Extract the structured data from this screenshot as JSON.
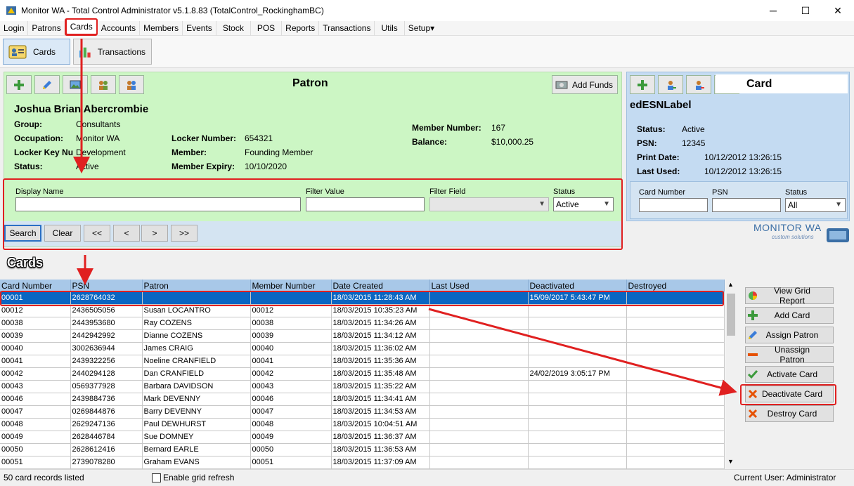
{
  "window": {
    "title": "Monitor WA - Total Control Administrator v5.1.8.83 (TotalControl_RockinghamBC)",
    "buttons": [
      "─",
      "☐",
      "✕"
    ]
  },
  "menu": [
    "Login",
    "Patrons",
    "Cards",
    "Accounts",
    "Members",
    "Events",
    "Stock",
    "POS",
    "Reports",
    "Transactions",
    "Utils",
    "Setup▾"
  ],
  "modules": {
    "cards": "Cards",
    "transactions": "Transactions"
  },
  "patron": {
    "title": "Patron",
    "add_funds": "Add Funds",
    "name": "Joshua Brian Abercrombie",
    "group_label": "Group:",
    "group": "Consultants",
    "occupation_label": "Occupation:",
    "occupation": "Monitor WA",
    "locker_key_label": "Locker Key Nu",
    "locker_key": "Development",
    "status_label": "Status:",
    "status": "Active",
    "locker_number_label": "Locker Number:",
    "locker_number": "654321",
    "member_label": "Member:",
    "member": "Founding Member",
    "member_expiry_label": "Member Expiry:",
    "member_expiry": "10/10/2020",
    "member_number_label": "Member Number:",
    "member_number": "167",
    "balance_label": "Balance:",
    "balance": "$10,000.25"
  },
  "filter": {
    "display_name": "Display Name",
    "filter_value": "Filter Value",
    "filter_field": "Filter Field",
    "status": "Status",
    "status_value": "Active",
    "search": "Search",
    "clear": "Clear",
    "first": "<<",
    "prev": "<",
    "next": ">",
    "last": ">>"
  },
  "card": {
    "title": "Card",
    "esn": "edESNLabel",
    "status_label": "Status:",
    "status": "Active",
    "psn_label": "PSN:",
    "psn": "12345",
    "print_date_label": "Print Date:",
    "print_date": "10/12/2012 13:26:15",
    "last_used_label": "Last Used:",
    "last_used": "10/12/2012 13:26:15",
    "card_number": "Card Number",
    "psn_filter": "PSN",
    "status_filter": "Status",
    "status_filter_value": "All"
  },
  "logo": {
    "name": "MONITOR WA",
    "tagline": "custom solutions"
  },
  "grid": {
    "title": "Cards",
    "columns": [
      "Card Number",
      "PSN",
      "Patron",
      "Member Number",
      "Date Created",
      "Last Used",
      "Deactivated",
      "Destroyed"
    ],
    "rows": [
      [
        "00001",
        "2628764032",
        "",
        "",
        "18/03/2015 11:28:43 AM",
        "",
        "15/09/2017 5:43:47 PM",
        ""
      ],
      [
        "00012",
        "2436505056",
        "Susan LOCANTRO",
        "00012",
        "18/03/2015 10:35:23 AM",
        "",
        "",
        ""
      ],
      [
        "00038",
        "2443953680",
        "Ray COZENS",
        "00038",
        "18/03/2015 11:34:26 AM",
        "",
        "",
        ""
      ],
      [
        "00039",
        "2442942992",
        "Dianne COZENS",
        "00039",
        "18/03/2015 11:34:12 AM",
        "",
        "",
        ""
      ],
      [
        "00040",
        "3002636944",
        "James CRAIG",
        "00040",
        "18/03/2015 11:36:02 AM",
        "",
        "",
        ""
      ],
      [
        "00041",
        "2439322256",
        "Noeline CRANFIELD",
        "00041",
        "18/03/2015 11:35:36 AM",
        "",
        "",
        ""
      ],
      [
        "00042",
        "2440294128",
        "Dan CRANFIELD",
        "00042",
        "18/03/2015 11:35:48 AM",
        "",
        "24/02/2019 3:05:17 PM",
        ""
      ],
      [
        "00043",
        "0569377928",
        "Barbara DAVIDSON",
        "00043",
        "18/03/2015 11:35:22 AM",
        "",
        "",
        ""
      ],
      [
        "00046",
        "2439884736",
        "Mark DEVENNY",
        "00046",
        "18/03/2015 11:34:41 AM",
        "",
        "",
        ""
      ],
      [
        "00047",
        "0269844876",
        "Barry DEVENNY",
        "00047",
        "18/03/2015 11:34:53 AM",
        "",
        "",
        ""
      ],
      [
        "00048",
        "2629247136",
        "Paul DEWHURST",
        "00048",
        "18/03/2015 10:04:51 AM",
        "",
        "",
        ""
      ],
      [
        "00049",
        "2628446784",
        "Sue DOMNEY",
        "00049",
        "18/03/2015 11:36:37 AM",
        "",
        "",
        ""
      ],
      [
        "00050",
        "2628612416",
        "Bernard EARLE",
        "00050",
        "18/03/2015 11:36:53 AM",
        "",
        "",
        ""
      ],
      [
        "00051",
        "2739078280",
        "Graham EVANS",
        "00051",
        "18/03/2015 11:37:09 AM",
        "",
        "",
        ""
      ]
    ]
  },
  "actions": [
    "View Grid Report",
    "Add Card",
    "Assign Patron",
    "Unassign Patron",
    "Activate Card",
    "Deactivate Card",
    "Destroy Card"
  ],
  "status": {
    "records": "50 card records listed",
    "refresh": "Enable grid refresh",
    "user": "Current User: Administrator"
  },
  "colors": {
    "accent_red": "#e02020",
    "selection": "#0a66c2",
    "patron_bg": "#ccf6c4",
    "card_bg": "#c4dbf2"
  }
}
